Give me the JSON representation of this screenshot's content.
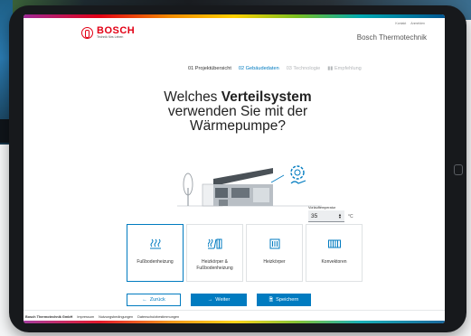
{
  "header": {
    "logo_text": "BOSCH",
    "logo_tagline": "Technik fürs Leben",
    "brand_right": "Bosch Thermotechnik",
    "top_links": [
      "Kontakt",
      "Anmelden"
    ]
  },
  "steps": [
    {
      "label": "01 Projektübersicht",
      "state": "done"
    },
    {
      "label": "02 Gebäudedaten",
      "state": "active"
    },
    {
      "label": "03 Technologie",
      "state": "inactive"
    },
    {
      "label": "Empfehlung",
      "state": "inactive"
    }
  ],
  "question": {
    "prefix": "Welches ",
    "bold": "Verteilsystem",
    "line2": "verwenden Sie mit der",
    "line3": "Wärmepumpe?"
  },
  "temperature": {
    "label": "Vorlauftemperatur",
    "value": "35",
    "unit": "°C"
  },
  "options": [
    {
      "label": "Fußbodenheizung",
      "icon": "floor-heating-icon",
      "selected": true
    },
    {
      "label_line1": "Heizkörper &",
      "label_line2": "Fußbodenheizung",
      "icon": "radiator-floor-heating-icon",
      "selected": false
    },
    {
      "label": "Heizkörper",
      "icon": "radiator-icon",
      "selected": false
    },
    {
      "label": "Konvektoren",
      "icon": "convector-icon",
      "selected": false
    }
  ],
  "buttons": {
    "back": "Zurück",
    "next": "Weiter",
    "save": "Speichern"
  },
  "footer": {
    "company": "Bosch Thermotechnik GmbH",
    "links": [
      "Impressum",
      "Nutzungsbedingungen",
      "Datenschutzbestimmungen"
    ]
  },
  "colors": {
    "accent": "#007bc0",
    "brand_red": "#e20015"
  }
}
